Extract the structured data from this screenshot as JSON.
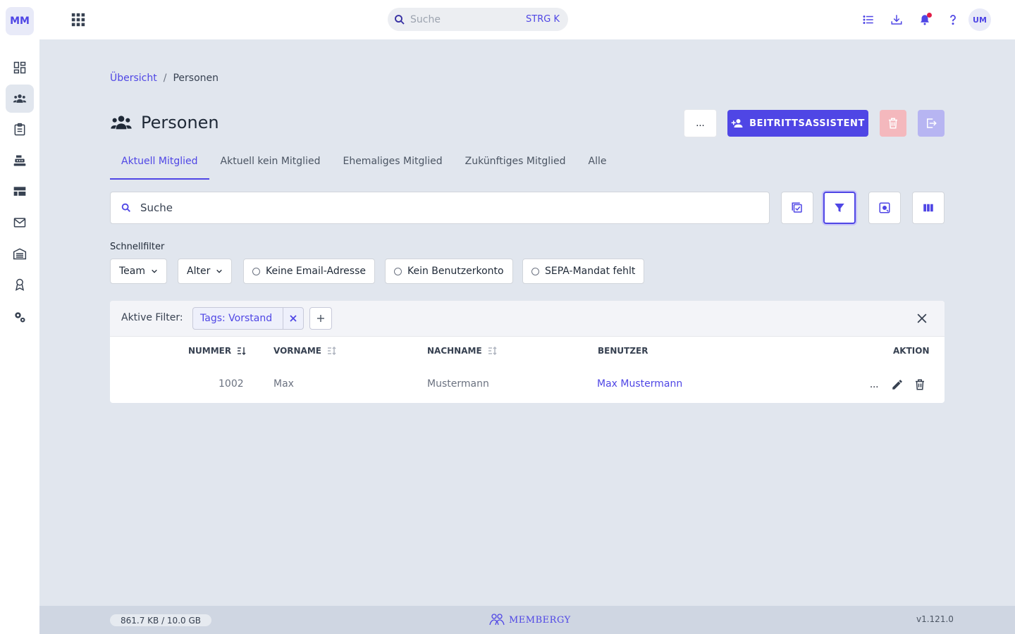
{
  "app": {
    "logo_initials": "MM",
    "user_initials": "UM"
  },
  "colors": {
    "accent": "#4f46e5",
    "background": "#e1e6ee",
    "danger_light": "#f4b8bd",
    "bell_dot": "#e11d48"
  },
  "sidebar": {
    "items": [
      {
        "name": "dashboard",
        "icon": "dashboard-icon",
        "active": false
      },
      {
        "name": "persons",
        "icon": "people-icon",
        "active": true
      },
      {
        "name": "clipboard",
        "icon": "clipboard-icon",
        "active": false
      },
      {
        "name": "cash-register",
        "icon": "cash-register-icon",
        "active": false
      },
      {
        "name": "table-view",
        "icon": "table-view-icon",
        "active": false
      },
      {
        "name": "mail",
        "icon": "mail-icon",
        "active": false
      },
      {
        "name": "warehouse",
        "icon": "warehouse-icon",
        "active": false
      },
      {
        "name": "award",
        "icon": "award-icon",
        "active": false
      },
      {
        "name": "settings",
        "icon": "gears-icon",
        "active": false
      }
    ]
  },
  "topbar": {
    "search_placeholder": "Suche",
    "search_shortcut": "STRG K",
    "icons": [
      "list-icon",
      "download-icon",
      "bell-icon",
      "help-icon"
    ]
  },
  "breadcrumb": {
    "link": "Übersicht",
    "separator": "/",
    "current": "Personen"
  },
  "page": {
    "title": "Personen",
    "more_label": "...",
    "primary_button": "BEITRITTSASSISTENT"
  },
  "tabs": [
    {
      "label": "Aktuell Mitglied",
      "active": true
    },
    {
      "label": "Aktuell kein Mitglied",
      "active": false
    },
    {
      "label": "Ehemaliges Mitglied",
      "active": false
    },
    {
      "label": "Zukünftiges Mitglied",
      "active": false
    },
    {
      "label": "Alle",
      "active": false
    }
  ],
  "search": {
    "placeholder": "Suche"
  },
  "quick_filter": {
    "label": "Schnellfilter",
    "dropdowns": [
      "Team",
      "Alter"
    ],
    "toggles": [
      "Keine Email-Adresse",
      "Kein Benutzerkonto",
      "SEPA-Mandat fehlt"
    ]
  },
  "active_filters": {
    "label": "Aktive Filter:",
    "chips": [
      "Tags: Vorstand"
    ]
  },
  "table": {
    "headers": {
      "number": "NUMMER",
      "firstname": "VORNAME",
      "lastname": "NACHNAME",
      "user": "BENUTZER",
      "action": "AKTION"
    },
    "rows": [
      {
        "number": "1002",
        "firstname": "Max",
        "lastname": "Mustermann",
        "user": "Max Mustermann",
        "more": "..."
      }
    ]
  },
  "footer": {
    "storage": "861.7 KB / 10.0 GB",
    "brand": "MEMBERGY",
    "version": "v1.121.0"
  }
}
